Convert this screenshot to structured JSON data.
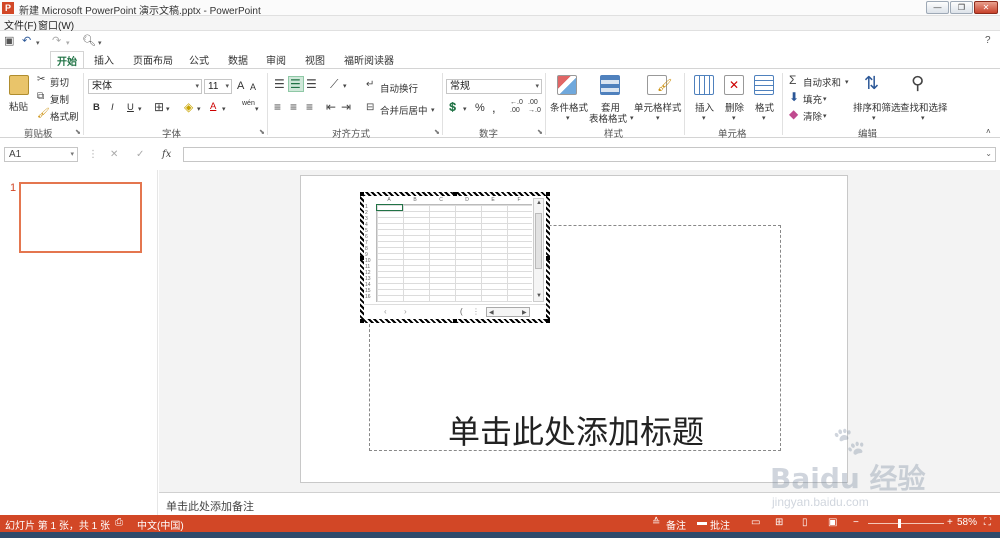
{
  "window": {
    "app_icon": "P",
    "title": "新建 Microsoft PowerPoint 演示文稿.pptx - PowerPoint",
    "min_glyph": "—",
    "max_glyph": "❐",
    "close_glyph": "✕"
  },
  "menubar": {
    "items": [
      {
        "label": "文件(F)"
      },
      {
        "label": "窗口(W)"
      }
    ]
  },
  "help_glyph": "?",
  "tabs": {
    "active": "开始",
    "items": [
      "插入",
      "页面布局",
      "公式",
      "数据",
      "审阅",
      "视图",
      "福昕阅读器"
    ]
  },
  "ribbon": {
    "clipboard": {
      "label": "剪贴板",
      "paste": "粘贴",
      "cut": "剪切",
      "copy": "复制",
      "format_painter": "格式刷"
    },
    "font": {
      "label": "字体",
      "name": "宋体",
      "size": "11",
      "bold": "B",
      "italic": "I",
      "underline": "U",
      "grow": "A",
      "shrink": "A",
      "font_color": "A",
      "phonetic": "wén"
    },
    "alignment": {
      "label": "对齐方式",
      "wrap_text": "自动换行",
      "merge_center": "合并后居中"
    },
    "number": {
      "label": "数字",
      "format": "常规",
      "percent": "%",
      "comma": ",",
      "inc_decimal": "←.0\n.00",
      "dec_decimal": ".00\n→.0"
    },
    "styles": {
      "label": "样式",
      "conditional": "条件格式",
      "table_line1": "套用",
      "table_line2": "表格格式",
      "cell_styles": "单元格样式"
    },
    "cells": {
      "label": "单元格",
      "insert": "插入",
      "delete": "删除",
      "format": "格式"
    },
    "editing": {
      "label": "编辑",
      "autosum": "自动求和",
      "fill": "填充",
      "clear": "清除",
      "sort_filter": "排序和筛选",
      "find_select": "查找和选择"
    }
  },
  "formula_bar": {
    "name_box": "A1",
    "fx": "fx",
    "cancel": "✕",
    "enter": "✓"
  },
  "thumbnails": [
    {
      "number": "1"
    }
  ],
  "slide": {
    "title_placeholder": "单击此处添加标题"
  },
  "embedded_sheet": {
    "columns": [
      "A",
      "B",
      "C",
      "D",
      "E",
      "F"
    ],
    "rows": [
      "1",
      "2",
      "3",
      "4",
      "5",
      "6",
      "7",
      "8",
      "9",
      "10",
      "11",
      "12",
      "13",
      "14",
      "15",
      "16"
    ]
  },
  "notes": {
    "placeholder": "单击此处添加备注"
  },
  "status": {
    "slide_info": "幻灯片 第 1 张，共 1 张",
    "language": "中文(中国)",
    "notes": "备注",
    "comments": "批注",
    "zoom": "58%"
  },
  "watermark": {
    "text": "Baidu 经验",
    "url": "jingyan.baidu.com"
  },
  "colors": {
    "accent": "#d24726",
    "excel_green": "#217346"
  }
}
